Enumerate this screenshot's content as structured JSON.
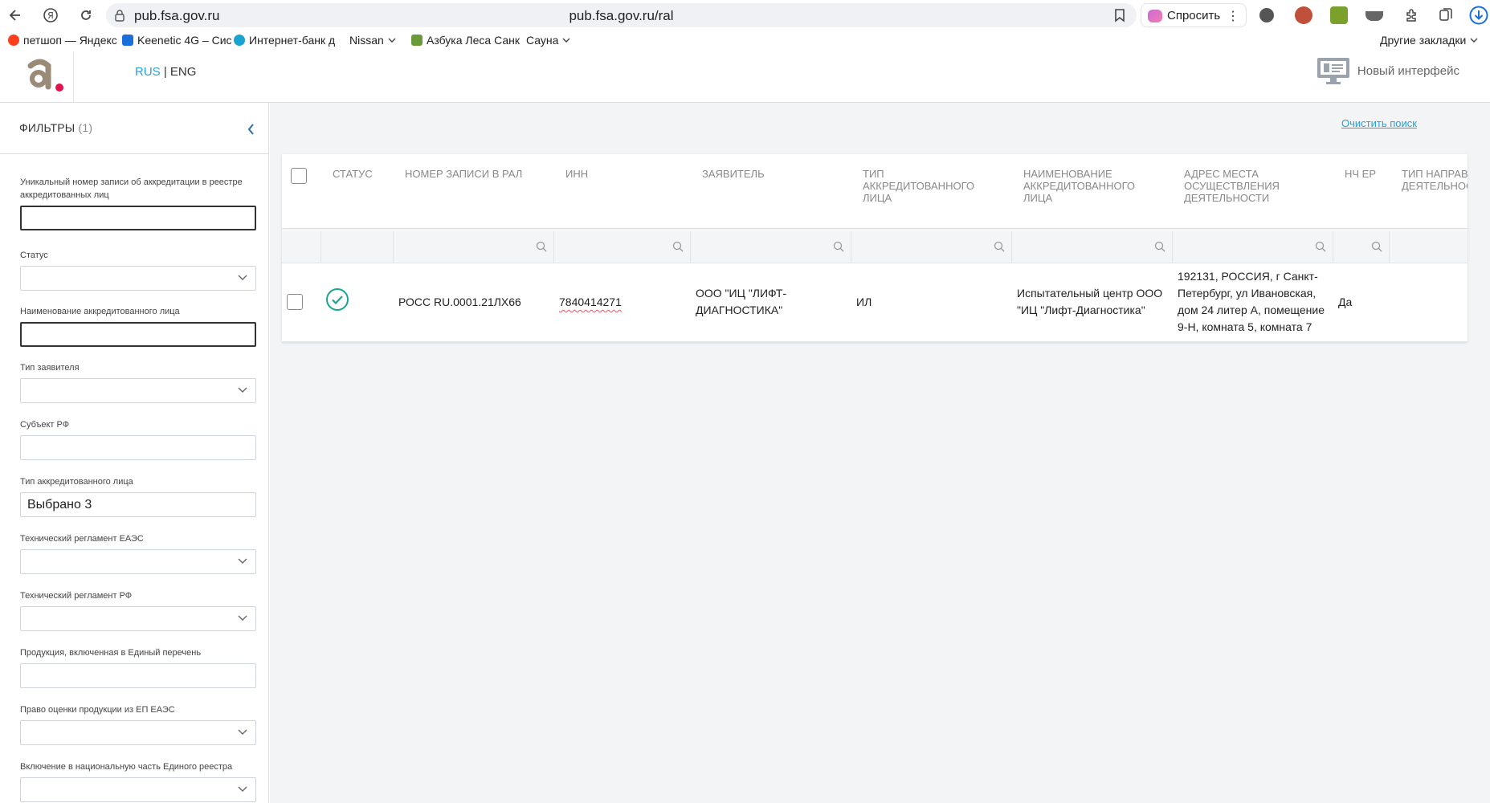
{
  "browser": {
    "domain": "pub.fsa.gov.ru",
    "url": "pub.fsa.gov.ru/ral",
    "ask_label": "Спросить",
    "bookmarks": [
      {
        "label": "петшоп — Яндекс",
        "icon": "yandex-icon"
      },
      {
        "label": "Keenetic 4G – Сис",
        "icon": "keenetic-icon"
      },
      {
        "label": "Интернет-банк д",
        "icon": "bank-icon"
      },
      {
        "label": "Nissan",
        "icon": "folder-chevron"
      },
      {
        "label": "Азбука Леса Санк",
        "icon": "forest-icon"
      },
      {
        "label": "Сауна",
        "icon": "folder-chevron"
      }
    ],
    "other_bookmarks": "Другие закладки"
  },
  "header": {
    "lang_rus": "RUS",
    "lang_sep": "|",
    "lang_eng": "ENG",
    "new_interface": "Новый интерфейс"
  },
  "sidebar": {
    "title": "ФИЛЬТРЫ",
    "count": "(1)",
    "filters": [
      {
        "label": "Уникальный номер записи об аккредитации в реестре аккредитованных лиц",
        "type": "text",
        "value": ""
      },
      {
        "label": "Статус",
        "type": "select",
        "value": ""
      },
      {
        "label": "Наименование аккредитованного лица",
        "type": "text",
        "value": ""
      },
      {
        "label": "Тип заявителя",
        "type": "select",
        "value": ""
      },
      {
        "label": "Субъект РФ",
        "type": "text",
        "value": ""
      },
      {
        "label": "Тип аккредитованного лица",
        "type": "text",
        "value": "Выбрано 3"
      },
      {
        "label": "Технический регламент ЕАЭС",
        "type": "select",
        "value": ""
      },
      {
        "label": "Технический регламент РФ",
        "type": "select",
        "value": ""
      },
      {
        "label": "Продукция, включенная в Единый перечень",
        "type": "text",
        "value": ""
      },
      {
        "label": "Право оценки продукции из ЕП ЕАЭС",
        "type": "select",
        "value": ""
      },
      {
        "label": "Включение в национальную часть Единого реестра",
        "type": "select",
        "value": ""
      }
    ]
  },
  "main": {
    "clear_search": "Очистить поиск",
    "columns": [
      {
        "label": "СТАТУС"
      },
      {
        "label": "НОМЕР ЗАПИСИ В РАЛ"
      },
      {
        "label": "ИНН"
      },
      {
        "label": "ЗАЯВИТЕЛЬ"
      },
      {
        "label": "ТИП АККРЕДИТОВАННОГО ЛИЦА"
      },
      {
        "label": "НАИМЕНОВАНИЕ АККРЕДИТОВАННОГО ЛИЦА"
      },
      {
        "label": "АДРЕС МЕСТА ОСУЩЕСТВЛЕНИЯ ДЕЯТЕЛЬНОСТИ"
      },
      {
        "label": "НЧ ЕР"
      },
      {
        "label": "ТИП НАПРАВЛЕНИЯ ДЕЯТЕЛЬНОСТИ"
      }
    ],
    "rows": [
      {
        "status": "check-circle-icon",
        "reg_number": "РОСС RU.0001.21ЛХ66",
        "inn": "7840414271",
        "applicant": "ООО \"ИЦ \"ЛИФТ-ДИАГНОСТИКА\"",
        "type": "ИЛ",
        "name": "Испытательный центр ООО \"ИЦ \"Лифт-Диагностика\"",
        "address": "192131, РОССИЯ, г Санкт-Петербург, ул Ивановская, дом 24 литер А, помещение 9-Н, комната 5, комната 7",
        "nch_er": "Да"
      }
    ]
  },
  "colors": {
    "accent": "#2a9fd6",
    "status_ok": "#1aa58f",
    "logo_red": "#e0134b",
    "logo_brown": "#9a8a78"
  }
}
